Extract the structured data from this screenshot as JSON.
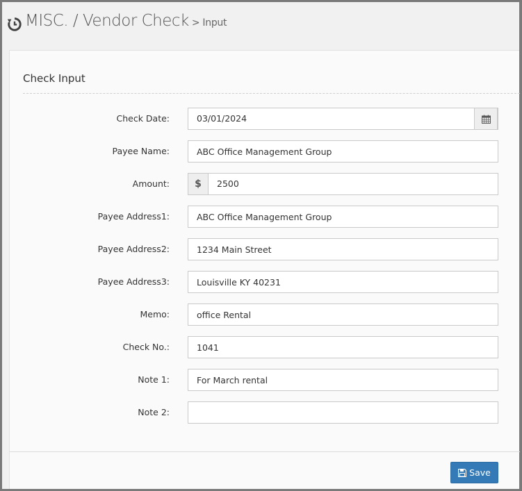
{
  "header": {
    "icon": "history-icon",
    "title": "MISC. / Vendor Check",
    "breadcrumb": "> Input"
  },
  "panel": {
    "title": "Check Input"
  },
  "form": {
    "check_date": {
      "label": "Check Date:",
      "value": "03/01/2024",
      "icon": "calendar-icon"
    },
    "payee_name": {
      "label": "Payee Name:",
      "value": "ABC Office Management Group"
    },
    "amount": {
      "label": "Amount:",
      "prefix": "$",
      "value": "2500"
    },
    "payee_address1": {
      "label": "Payee Address1:",
      "value": "ABC Office Management Group"
    },
    "payee_address2": {
      "label": "Payee Address2:",
      "value": "1234 Main Street"
    },
    "payee_address3": {
      "label": "Payee Address3:",
      "value": "Louisville KY 40231"
    },
    "memo": {
      "label": "Memo:",
      "value": "office Rental"
    },
    "check_no": {
      "label": "Check No.:",
      "value": "1041"
    },
    "note1": {
      "label": "Note 1:",
      "value": "For March rental"
    },
    "note2": {
      "label": "Note 2:",
      "value": ""
    }
  },
  "actions": {
    "save_label": "Save",
    "save_icon": "floppy-disk-icon",
    "save_color": "#337ab7"
  }
}
